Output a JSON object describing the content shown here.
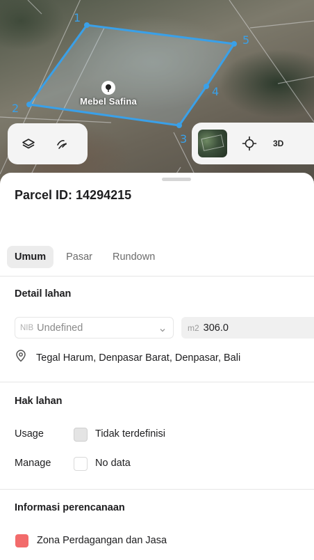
{
  "map": {
    "poi_label": "Mebel Safina",
    "vertex_labels": [
      "1",
      "2",
      "3",
      "4",
      "5"
    ],
    "parcel_color": "#3aa0e8",
    "controls": {
      "layers_icon": "layers-icon",
      "draw_icon": "draw-icon",
      "satellite_icon": "satellite-thumbnail",
      "locate_icon": "crosshair-icon",
      "three_d_label": "3D"
    }
  },
  "sheet": {
    "title": "Parcel ID: 14294215",
    "tabs": [
      {
        "label": "Umum",
        "active": true
      },
      {
        "label": "Pasar",
        "active": false
      },
      {
        "label": "Rundown",
        "active": false
      }
    ]
  },
  "detail": {
    "title": "Detail lahan",
    "nib_prefix": "NIB",
    "nib_value": "Undefined",
    "area_unit": "m2",
    "area_value": "306.0",
    "address": "Tegal Harum, Denpasar Barat, Denpasar, Bali"
  },
  "hak": {
    "title": "Hak lahan",
    "usage_label": "Usage",
    "usage_value": "Tidak terdefinisi",
    "manage_label": "Manage",
    "manage_value": "No data"
  },
  "perencanaan": {
    "title": "Informasi perencanaan",
    "zone_label": "Zona Perdagangan dan Jasa",
    "zone_color": "#f26b6b"
  }
}
